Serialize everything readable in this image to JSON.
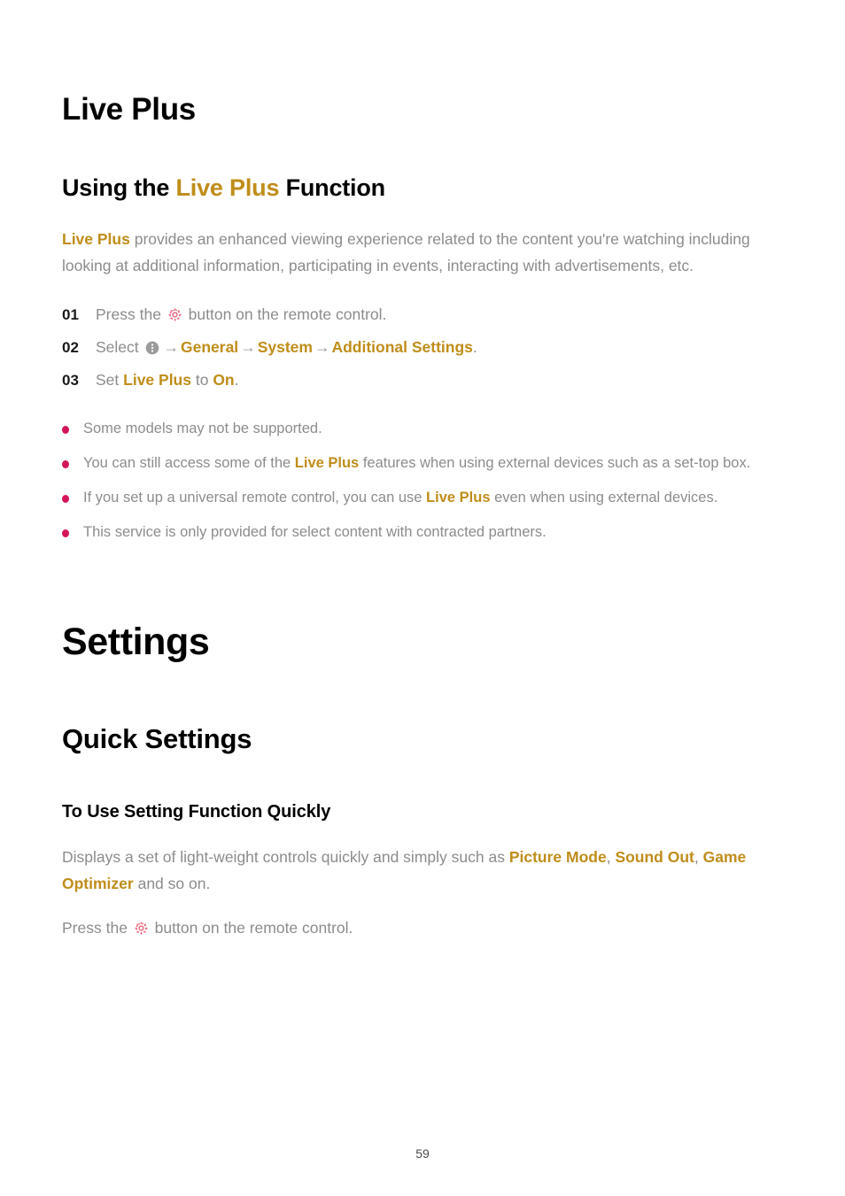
{
  "document": {
    "page_number": "59"
  },
  "colors": {
    "gold": "#bf8d1a",
    "bullet": "#d4145a",
    "body_text": "#8c8c8c",
    "heading": "#000000",
    "gear_icon": "#e8647a",
    "kebab_icon": "#9b9b9b"
  },
  "chapter": {
    "title": "Live Plus"
  },
  "section_using": {
    "heading_prefix": "Using the ",
    "heading_highlight": "Live Plus",
    "heading_suffix": " Function",
    "intro": {
      "lead": "Live Plus",
      "rest": " provides an enhanced viewing experience related to the content you're watching including looking at additional information, participating in events, interacting with advertisements, etc."
    },
    "steps": [
      {
        "number": "01",
        "before_icon": "Press the ",
        "icon": "gear-icon",
        "after_icon": " button on the remote control."
      },
      {
        "number": "02",
        "before_icon": "Select ",
        "icon": "kebab-circle-icon",
        "arrow": "→",
        "path": [
          "General",
          "System",
          "Additional Settings"
        ],
        "trailing": "."
      },
      {
        "number": "03",
        "prefix": "Set ",
        "term1": "Live Plus",
        "middle": " to ",
        "term2": "On",
        "trailing": "."
      }
    ],
    "notes": [
      {
        "parts": [
          {
            "text": "Some models may not be supported.",
            "style": "plain"
          }
        ]
      },
      {
        "parts": [
          {
            "text": "You can still access some of the ",
            "style": "plain"
          },
          {
            "text": "Live Plus",
            "style": "gold"
          },
          {
            "text": " features when using external devices such as a set-top box.",
            "style": "plain"
          }
        ]
      },
      {
        "parts": [
          {
            "text": "If you set up a universal remote control, you can use ",
            "style": "plain"
          },
          {
            "text": "Live Plus",
            "style": "gold"
          },
          {
            "text": " even when using external devices.",
            "style": "plain"
          }
        ]
      },
      {
        "parts": [
          {
            "text": "This service is only provided for select content with contracted partners.",
            "style": "plain"
          }
        ]
      }
    ]
  },
  "chapter2": {
    "title": "Settings"
  },
  "section_quick": {
    "heading": "Quick Settings",
    "subheading": "To Use Setting Function Quickly",
    "desc_parts": [
      {
        "text": "Displays a set of light-weight controls quickly and simply such as ",
        "style": "plain"
      },
      {
        "text": "Picture Mode",
        "style": "gold"
      },
      {
        "text": ", ",
        "style": "plain"
      },
      {
        "text": "Sound Out",
        "style": "gold"
      },
      {
        "text": ", ",
        "style": "plain"
      },
      {
        "text": "Game Optimizer",
        "style": "gold"
      },
      {
        "text": " and so on.",
        "style": "plain"
      }
    ],
    "press_before": "Press the ",
    "press_after": " button on the remote control."
  }
}
